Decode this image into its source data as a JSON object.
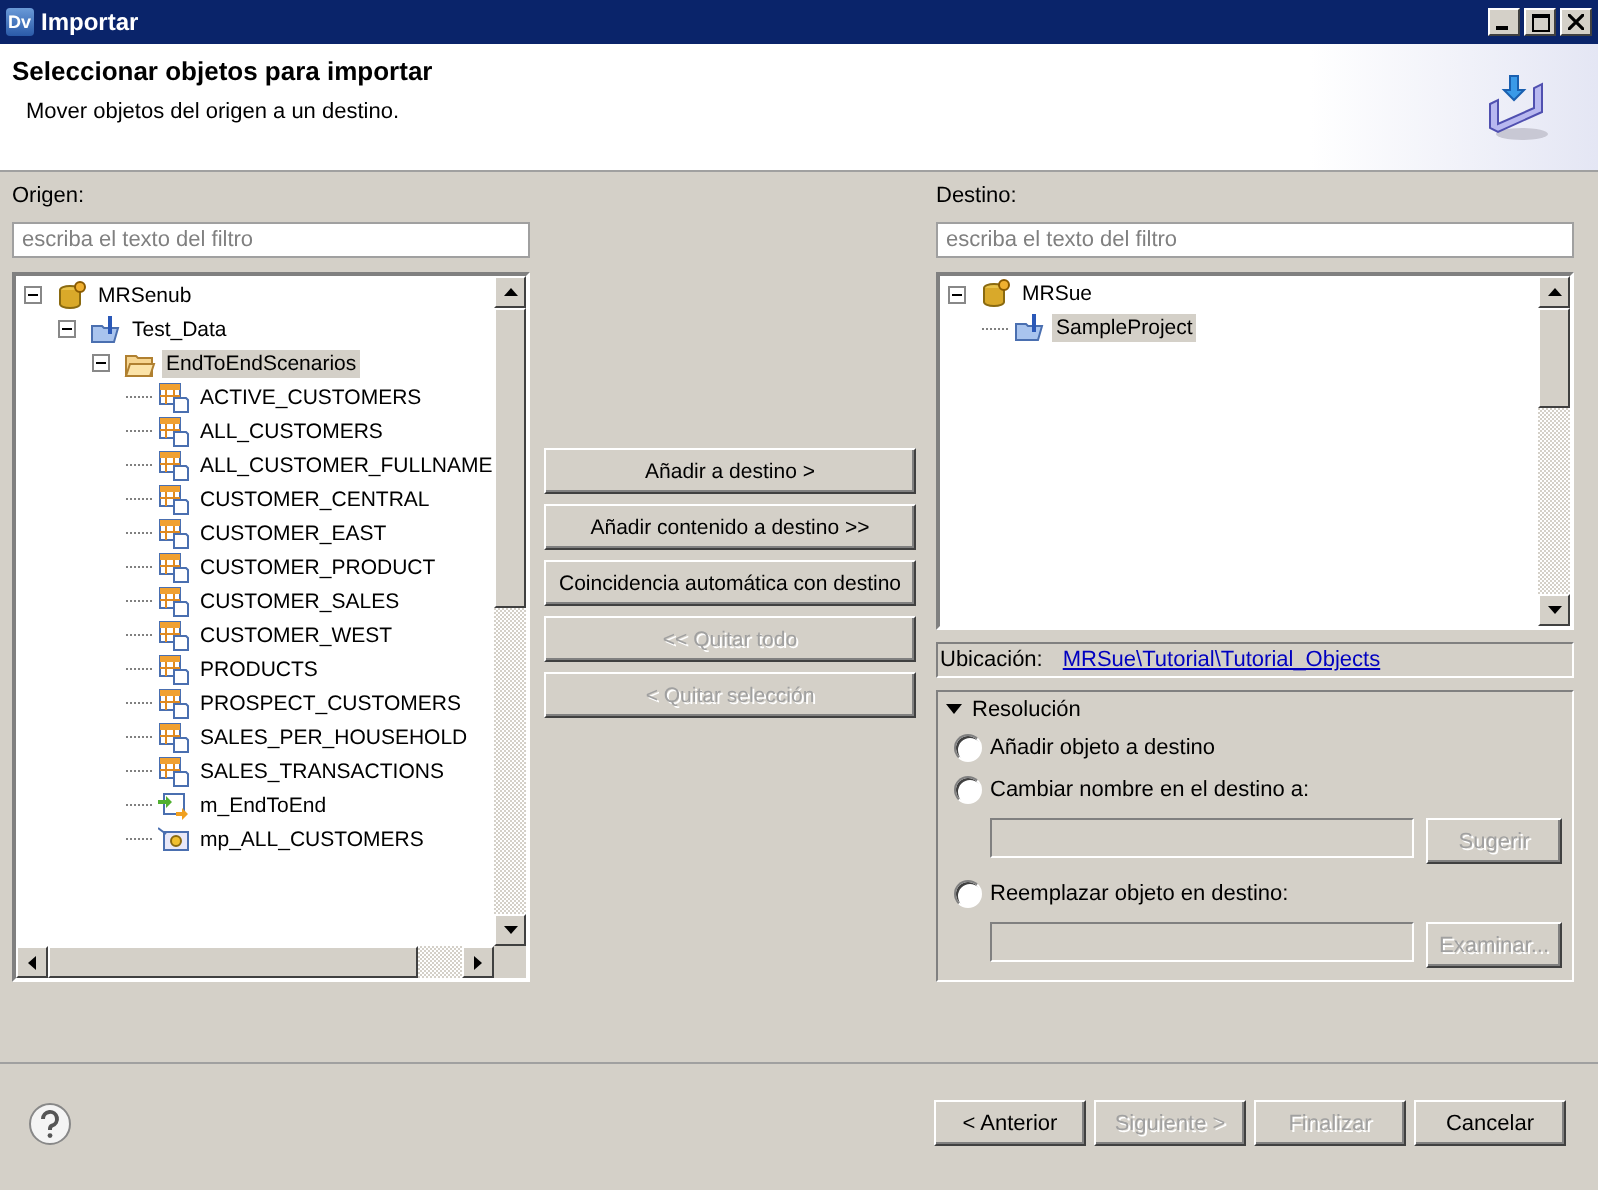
{
  "window": {
    "title": "Importar",
    "app_icon_text": "Dv"
  },
  "header": {
    "title": "Seleccionar objetos para importar",
    "subtitle": "Mover objetos del origen a un destino."
  },
  "source": {
    "label": "Origen:",
    "filter": {
      "placeholder": "escriba el texto del filtro"
    },
    "tree": [
      {
        "label": "MRSenub",
        "kind": "repository",
        "expanded": true,
        "selected": false,
        "children": [
          {
            "label": "Test_Data",
            "kind": "project",
            "expanded": true,
            "selected": false,
            "children": [
              {
                "label": "EndToEndScenarios",
                "kind": "folder",
                "expanded": true,
                "selected": true,
                "children": [
                  {
                    "label": "ACTIVE_CUSTOMERS",
                    "kind": "table",
                    "selected": false
                  },
                  {
                    "label": "ALL_CUSTOMERS",
                    "kind": "table",
                    "selected": false
                  },
                  {
                    "label": "ALL_CUSTOMER_FULLNAME",
                    "kind": "table",
                    "selected": false
                  },
                  {
                    "label": "CUSTOMER_CENTRAL",
                    "kind": "table",
                    "selected": false
                  },
                  {
                    "label": "CUSTOMER_EAST",
                    "kind": "table",
                    "selected": false
                  },
                  {
                    "label": "CUSTOMER_PRODUCT",
                    "kind": "table",
                    "selected": false
                  },
                  {
                    "label": "CUSTOMER_SALES",
                    "kind": "table",
                    "selected": false
                  },
                  {
                    "label": "CUSTOMER_WEST",
                    "kind": "table",
                    "selected": false
                  },
                  {
                    "label": "PRODUCTS",
                    "kind": "table",
                    "selected": false
                  },
                  {
                    "label": "PROSPECT_CUSTOMERS",
                    "kind": "table",
                    "selected": false
                  },
                  {
                    "label": "SALES_PER_HOUSEHOLD",
                    "kind": "table",
                    "selected": false
                  },
                  {
                    "label": "SALES_TRANSACTIONS",
                    "kind": "table",
                    "selected": false
                  },
                  {
                    "label": "m_EndToEnd",
                    "kind": "mapping",
                    "selected": false
                  },
                  {
                    "label": "mp_ALL_CUSTOMERS",
                    "kind": "mapplet",
                    "selected": false
                  }
                ]
              }
            ]
          }
        ]
      }
    ]
  },
  "actions": [
    {
      "label": "Añadir a destino >",
      "disabled": false
    },
    {
      "label": "Añadir contenido a destino >>",
      "disabled": false
    },
    {
      "label": "Coincidencia automática con destino",
      "disabled": false
    },
    {
      "label": "<< Quitar todo",
      "disabled": true
    },
    {
      "label": "< Quitar selección",
      "disabled": true
    }
  ],
  "target": {
    "label": "Destino:",
    "filter": {
      "placeholder": "escriba el texto del filtro"
    },
    "tree": [
      {
        "label": "MRSue",
        "kind": "repository",
        "expanded": true,
        "selected": false,
        "children": [
          {
            "label": "SampleProject",
            "kind": "project",
            "selected": true
          }
        ]
      }
    ],
    "location": {
      "label": "Ubicación:",
      "link": "MRSue\\Tutorial\\Tutorial_Objects"
    }
  },
  "resolution": {
    "title": "Resolución",
    "expanded": true,
    "options": [
      {
        "label": "Añadir objeto a destino",
        "checked": false
      },
      {
        "label": "Cambiar nombre en el destino a:",
        "checked": false,
        "field_disabled": true,
        "button": {
          "label": "Sugerir",
          "disabled": true
        }
      },
      {
        "label": "Reemplazar objeto en destino:",
        "checked": false,
        "field_disabled": true,
        "button": {
          "label": "Examinar...",
          "disabled": true
        }
      }
    ]
  },
  "footer": {
    "buttons": [
      {
        "label": "< Anterior",
        "disabled": false
      },
      {
        "label": "Siguiente >",
        "disabled": true
      },
      {
        "label": "Finalizar",
        "disabled": true
      },
      {
        "label": "Cancelar",
        "disabled": false
      }
    ]
  }
}
